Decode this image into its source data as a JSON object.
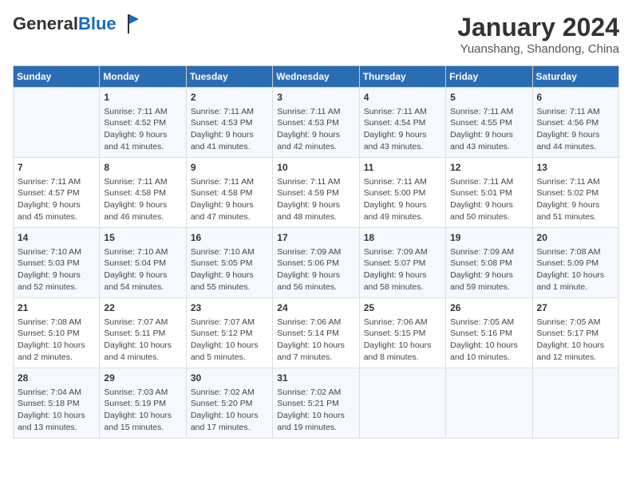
{
  "header": {
    "logo_general": "General",
    "logo_blue": "Blue",
    "month_year": "January 2024",
    "location": "Yuanshang, Shandong, China"
  },
  "days_of_week": [
    "Sunday",
    "Monday",
    "Tuesday",
    "Wednesday",
    "Thursday",
    "Friday",
    "Saturday"
  ],
  "weeks": [
    [
      {
        "day": "",
        "content": ""
      },
      {
        "day": "1",
        "content": "Sunrise: 7:11 AM\nSunset: 4:52 PM\nDaylight: 9 hours\nand 41 minutes."
      },
      {
        "day": "2",
        "content": "Sunrise: 7:11 AM\nSunset: 4:53 PM\nDaylight: 9 hours\nand 41 minutes."
      },
      {
        "day": "3",
        "content": "Sunrise: 7:11 AM\nSunset: 4:53 PM\nDaylight: 9 hours\nand 42 minutes."
      },
      {
        "day": "4",
        "content": "Sunrise: 7:11 AM\nSunset: 4:54 PM\nDaylight: 9 hours\nand 43 minutes."
      },
      {
        "day": "5",
        "content": "Sunrise: 7:11 AM\nSunset: 4:55 PM\nDaylight: 9 hours\nand 43 minutes."
      },
      {
        "day": "6",
        "content": "Sunrise: 7:11 AM\nSunset: 4:56 PM\nDaylight: 9 hours\nand 44 minutes."
      }
    ],
    [
      {
        "day": "7",
        "content": "Sunrise: 7:11 AM\nSunset: 4:57 PM\nDaylight: 9 hours\nand 45 minutes."
      },
      {
        "day": "8",
        "content": "Sunrise: 7:11 AM\nSunset: 4:58 PM\nDaylight: 9 hours\nand 46 minutes."
      },
      {
        "day": "9",
        "content": "Sunrise: 7:11 AM\nSunset: 4:58 PM\nDaylight: 9 hours\nand 47 minutes."
      },
      {
        "day": "10",
        "content": "Sunrise: 7:11 AM\nSunset: 4:59 PM\nDaylight: 9 hours\nand 48 minutes."
      },
      {
        "day": "11",
        "content": "Sunrise: 7:11 AM\nSunset: 5:00 PM\nDaylight: 9 hours\nand 49 minutes."
      },
      {
        "day": "12",
        "content": "Sunrise: 7:11 AM\nSunset: 5:01 PM\nDaylight: 9 hours\nand 50 minutes."
      },
      {
        "day": "13",
        "content": "Sunrise: 7:11 AM\nSunset: 5:02 PM\nDaylight: 9 hours\nand 51 minutes."
      }
    ],
    [
      {
        "day": "14",
        "content": "Sunrise: 7:10 AM\nSunset: 5:03 PM\nDaylight: 9 hours\nand 52 minutes."
      },
      {
        "day": "15",
        "content": "Sunrise: 7:10 AM\nSunset: 5:04 PM\nDaylight: 9 hours\nand 54 minutes."
      },
      {
        "day": "16",
        "content": "Sunrise: 7:10 AM\nSunset: 5:05 PM\nDaylight: 9 hours\nand 55 minutes."
      },
      {
        "day": "17",
        "content": "Sunrise: 7:09 AM\nSunset: 5:06 PM\nDaylight: 9 hours\nand 56 minutes."
      },
      {
        "day": "18",
        "content": "Sunrise: 7:09 AM\nSunset: 5:07 PM\nDaylight: 9 hours\nand 58 minutes."
      },
      {
        "day": "19",
        "content": "Sunrise: 7:09 AM\nSunset: 5:08 PM\nDaylight: 9 hours\nand 59 minutes."
      },
      {
        "day": "20",
        "content": "Sunrise: 7:08 AM\nSunset: 5:09 PM\nDaylight: 10 hours\nand 1 minute."
      }
    ],
    [
      {
        "day": "21",
        "content": "Sunrise: 7:08 AM\nSunset: 5:10 PM\nDaylight: 10 hours\nand 2 minutes."
      },
      {
        "day": "22",
        "content": "Sunrise: 7:07 AM\nSunset: 5:11 PM\nDaylight: 10 hours\nand 4 minutes."
      },
      {
        "day": "23",
        "content": "Sunrise: 7:07 AM\nSunset: 5:12 PM\nDaylight: 10 hours\nand 5 minutes."
      },
      {
        "day": "24",
        "content": "Sunrise: 7:06 AM\nSunset: 5:14 PM\nDaylight: 10 hours\nand 7 minutes."
      },
      {
        "day": "25",
        "content": "Sunrise: 7:06 AM\nSunset: 5:15 PM\nDaylight: 10 hours\nand 8 minutes."
      },
      {
        "day": "26",
        "content": "Sunrise: 7:05 AM\nSunset: 5:16 PM\nDaylight: 10 hours\nand 10 minutes."
      },
      {
        "day": "27",
        "content": "Sunrise: 7:05 AM\nSunset: 5:17 PM\nDaylight: 10 hours\nand 12 minutes."
      }
    ],
    [
      {
        "day": "28",
        "content": "Sunrise: 7:04 AM\nSunset: 5:18 PM\nDaylight: 10 hours\nand 13 minutes."
      },
      {
        "day": "29",
        "content": "Sunrise: 7:03 AM\nSunset: 5:19 PM\nDaylight: 10 hours\nand 15 minutes."
      },
      {
        "day": "30",
        "content": "Sunrise: 7:02 AM\nSunset: 5:20 PM\nDaylight: 10 hours\nand 17 minutes."
      },
      {
        "day": "31",
        "content": "Sunrise: 7:02 AM\nSunset: 5:21 PM\nDaylight: 10 hours\nand 19 minutes."
      },
      {
        "day": "",
        "content": ""
      },
      {
        "day": "",
        "content": ""
      },
      {
        "day": "",
        "content": ""
      }
    ]
  ]
}
